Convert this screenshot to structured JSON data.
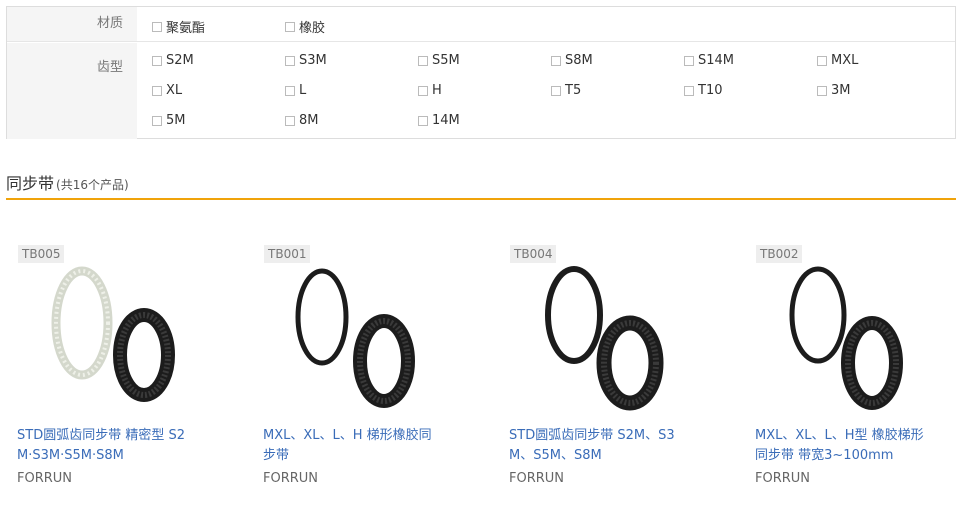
{
  "filters": {
    "material": {
      "label": "材质",
      "options": [
        "聚氨酯",
        "橡胶"
      ]
    },
    "tooth": {
      "label": "齿型",
      "options": [
        "S2M",
        "S3M",
        "S5M",
        "S8M",
        "S14M",
        "MXL",
        "XL",
        "L",
        "H",
        "T5",
        "T10",
        "3M",
        "5M",
        "8M",
        "14M"
      ]
    }
  },
  "section": {
    "title": "同步带",
    "count": "(共16个产品)"
  },
  "products": [
    {
      "code": "TB005",
      "name_line1": "STD圆弧齿同步带 精密型 S2",
      "name_line2": "M·S3M·S5M·S8M",
      "brand": "FORRUN",
      "image": "white-belt-and-black-belt"
    },
    {
      "code": "TB001",
      "name_line1": "MXL、XL、L、H 梯形橡胶同",
      "name_line2": "步带",
      "brand": "FORRUN",
      "image": "black-belts"
    },
    {
      "code": "TB004",
      "name_line1": "STD圆弧齿同步带 S2M、S3",
      "name_line2": "M、S5M、S8M",
      "brand": "FORRUN",
      "image": "black-belts"
    },
    {
      "code": "TB002",
      "name_line1": "MXL、XL、L、H型 橡胶梯形",
      "name_line2": "同步带 带宽3~100mm",
      "brand": "FORRUN",
      "image": "black-belts"
    }
  ],
  "colors": {
    "accent": "#f0a30a",
    "link": "#3a6cb8"
  }
}
